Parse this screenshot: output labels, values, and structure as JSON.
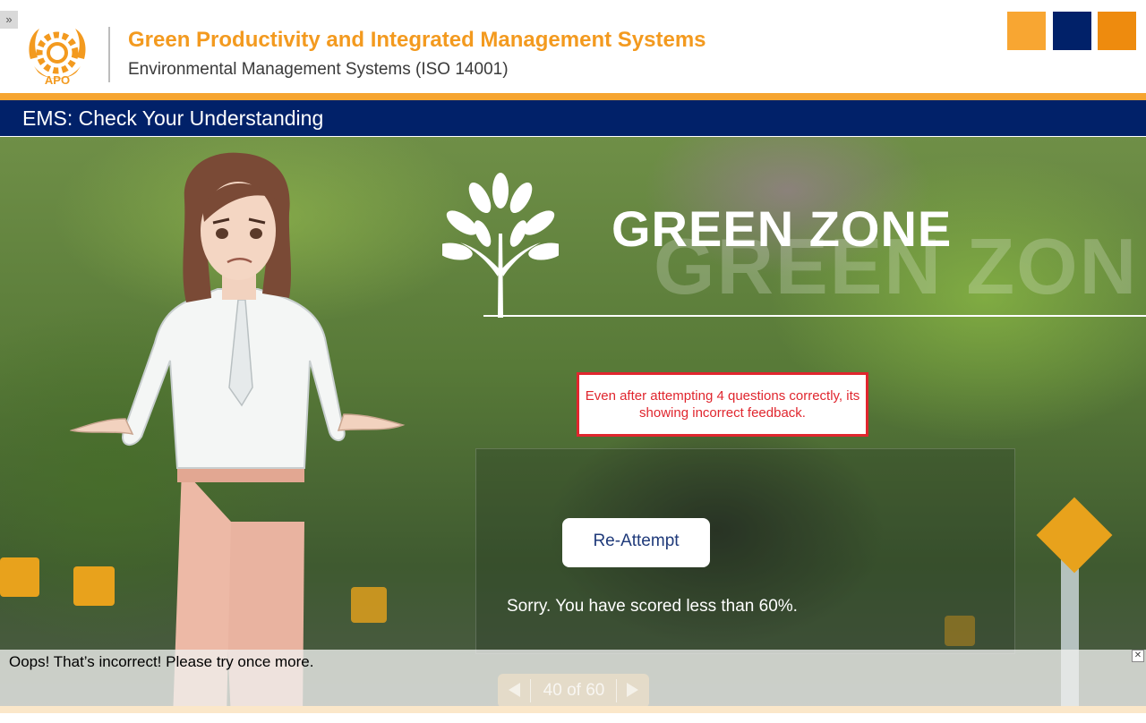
{
  "header": {
    "toggle_glyph": "»",
    "title": "Green Productivity and Integrated Management Systems",
    "subtitle": "Environmental Management Systems (ISO 14001)",
    "logo_text": "APO",
    "squares": [
      "#f8a632",
      "#012169",
      "#ee8b0e"
    ]
  },
  "navbar": {
    "title": "EMS: Check Your Understanding"
  },
  "stage": {
    "heading": "GREEN ZONE",
    "watermark": "GREEN ZON",
    "annotation": "Even after attempting 4 questions correctly, its showing incorrect feedback.",
    "reattempt_label": "Re-Attempt",
    "score_message": "Sorry. You have scored less than 60%."
  },
  "feedback": {
    "message": "Oops! That’s incorrect! Please try once more.",
    "close_glyph": "✕"
  },
  "pager": {
    "text": "40 of 60"
  },
  "colors": {
    "brand_orange": "#f39a1f",
    "brand_navy": "#012169",
    "annotation_red": "#e0262e"
  }
}
